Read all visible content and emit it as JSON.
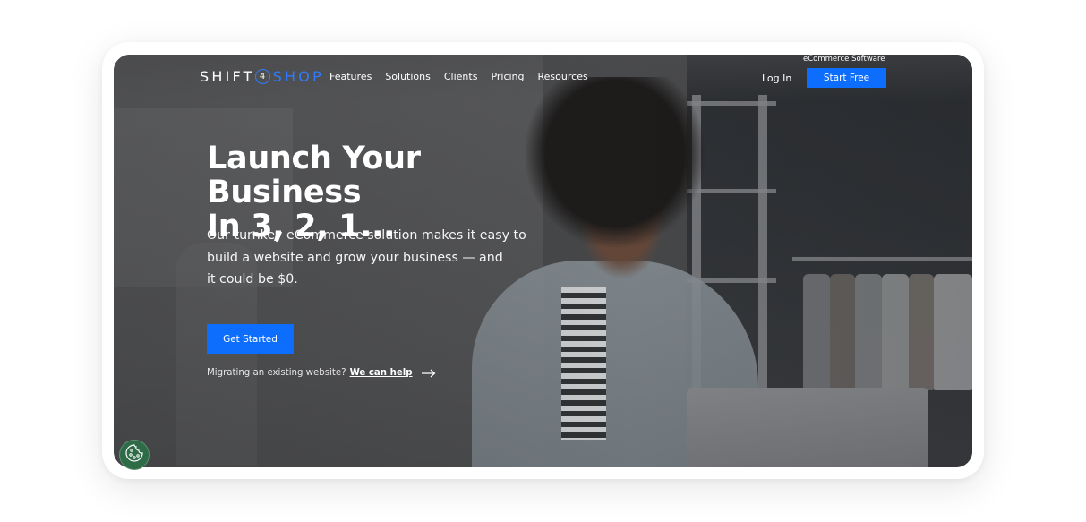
{
  "brand": {
    "logo_left": "SHIFT",
    "logo_mid": "4",
    "logo_right": "SHOP",
    "tagline": "eCommerce Software",
    "accent_color": "#0d6efd",
    "logo_blue": "#2f7bff"
  },
  "nav": {
    "links": [
      {
        "label": "Features"
      },
      {
        "label": "Solutions"
      },
      {
        "label": "Clients"
      },
      {
        "label": "Pricing"
      },
      {
        "label": "Resources"
      }
    ],
    "login_label": "Log In",
    "start_free_label": "Start Free"
  },
  "hero": {
    "headline_line1": "Launch Your Business",
    "headline_line2": "In 3, 2, 1...",
    "subtext_lines": [
      "Our turnkey eCommerce solution makes it easy to",
      "build a website and grow your business — and",
      "it could be $0."
    ],
    "cta_label": "Get Started",
    "migrate_text": "Migrating an existing website?",
    "migrate_link": "We can help"
  },
  "icons": {
    "cookie": "cookie-icon",
    "arrow": "arrow-right-icon"
  },
  "cookie_button_color": "#2e6b47"
}
